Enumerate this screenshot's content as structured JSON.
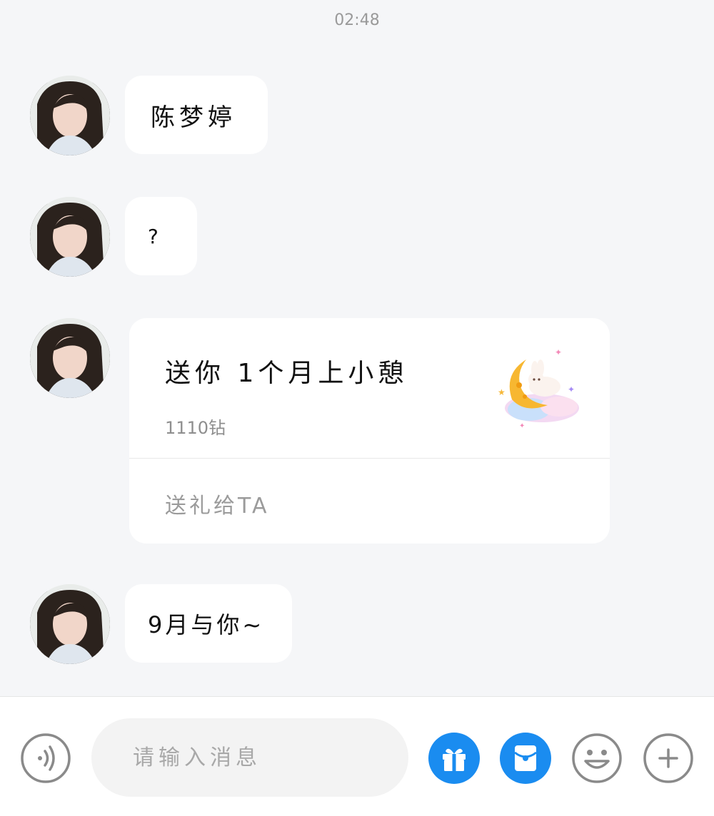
{
  "chat": {
    "timestamp": "02:48",
    "messages": [
      {
        "type": "text",
        "text": "陈梦婷"
      },
      {
        "type": "text",
        "text": "?"
      },
      {
        "type": "gift",
        "title": "送你 1个月上小憩",
        "price": "1110钻",
        "action": "送礼给TA"
      },
      {
        "type": "text",
        "text": "9月与你~"
      }
    ]
  },
  "input_bar": {
    "placeholder": "请输入消息",
    "icons": [
      "voice-icon",
      "gift-icon",
      "red-packet-icon",
      "emoji-icon",
      "plus-icon"
    ],
    "accent_color": "#1a8cf0",
    "outline_color": "#8a8a8a"
  }
}
